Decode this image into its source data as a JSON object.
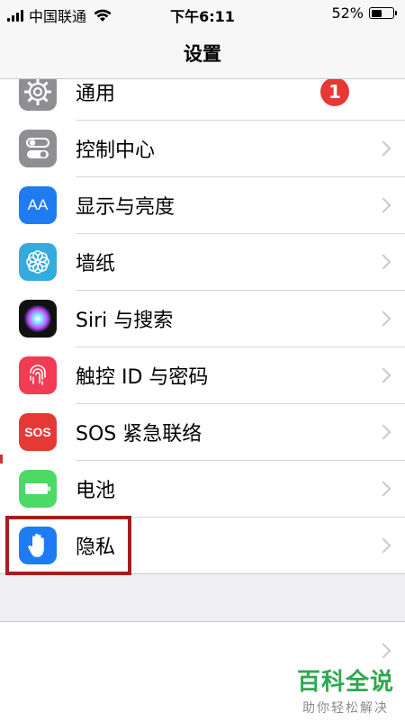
{
  "status_bar": {
    "carrier": "中国联通",
    "time": "下午6:11",
    "battery_percent_text": "52%",
    "battery_level": 0.52
  },
  "nav": {
    "title": "设置"
  },
  "list": {
    "items": [
      {
        "label": "通用",
        "icon": "gear-icon",
        "badge": "1"
      },
      {
        "label": "控制中心",
        "icon": "toggles-icon"
      },
      {
        "label": "显示与亮度",
        "icon": "text-size-icon",
        "icon_text": "AA"
      },
      {
        "label": "墙纸",
        "icon": "flower-icon"
      },
      {
        "label": "Siri 与搜索",
        "icon": "siri-icon"
      },
      {
        "label": "触控 ID 与密码",
        "icon": "fingerprint-icon"
      },
      {
        "label": "SOS 紧急联络",
        "icon": "sos-icon",
        "icon_text": "SOS"
      },
      {
        "label": "电池",
        "icon": "battery-icon"
      },
      {
        "label": "隐私",
        "icon": "hand-icon"
      }
    ]
  },
  "colors": {
    "highlight": "#a51d1d",
    "badge": "#e53935",
    "watermark": "#2fa84f"
  },
  "watermark": {
    "title": "百科全说",
    "subtitle": "助你轻松解决"
  }
}
